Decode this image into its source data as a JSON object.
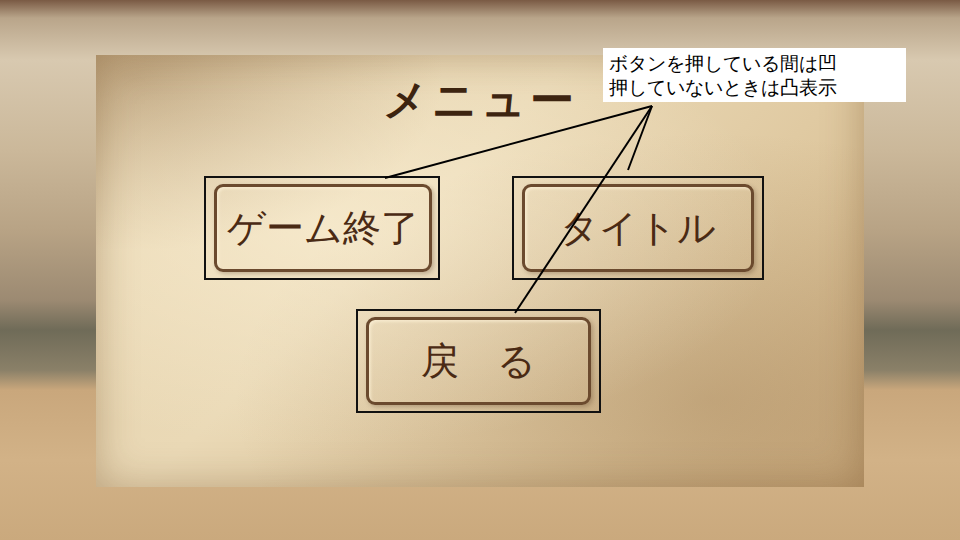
{
  "menu": {
    "title": "メニュー",
    "buttons": [
      {
        "label": "ゲーム終了",
        "pressed": false
      },
      {
        "label": "タイトル",
        "pressed": false
      },
      {
        "label": "戻　る",
        "pressed": false
      }
    ]
  },
  "annotation": {
    "lines": [
      "ボタンを押している間は凹",
      "押していないときは凸表示"
    ]
  }
}
